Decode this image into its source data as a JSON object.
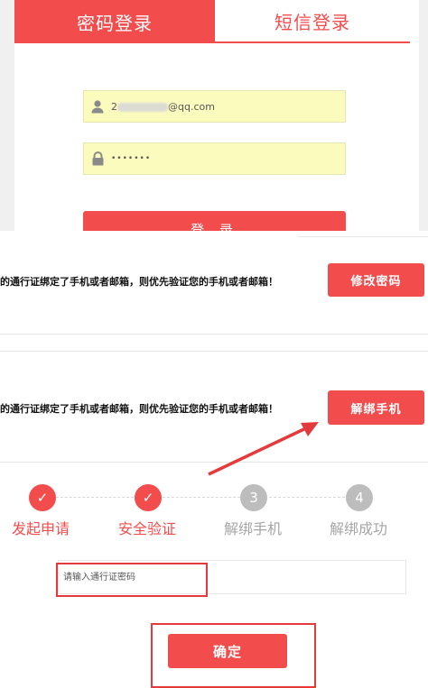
{
  "login": {
    "tab_password": "密码登录",
    "tab_sms": "短信登录",
    "email_prefix": "2",
    "email_suffix": "@qq.com",
    "password_mask": "•••••••",
    "login_button": "登 录"
  },
  "account": {
    "rows": [
      {
        "text": "的通行证绑定了手机或者邮箱，则优先验证您的手机或者邮箱！",
        "button": "修改密码"
      },
      {
        "text": "的通行证绑定了手机或者邮箱，则优先验证您的手机或者邮箱！",
        "button": "解绑手机"
      }
    ]
  },
  "steps": [
    {
      "label": "发起申请",
      "state": "done",
      "mark": "✓"
    },
    {
      "label": "安全验证",
      "state": "done",
      "mark": "✓"
    },
    {
      "label": "解绑手机",
      "state": "todo",
      "mark": "3"
    },
    {
      "label": "解绑成功",
      "state": "todo",
      "mark": "4"
    }
  ],
  "verify": {
    "password_placeholder": "请输入通行证密码",
    "confirm_button": "确定"
  },
  "colors": {
    "brand_red": "#f24c4d",
    "field_yellow": "#fbfbbe",
    "step_inactive": "#bdbdbd",
    "highlight": "#e43a3b"
  }
}
